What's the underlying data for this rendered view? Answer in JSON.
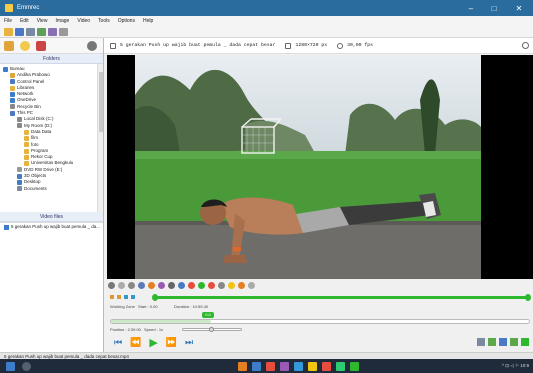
{
  "window": {
    "title": "Emmrec",
    "minimize_glyph": "–",
    "maximize_glyph": "□",
    "close_glyph": "✕"
  },
  "menu": [
    "File",
    "Edit",
    "View",
    "Image",
    "Video",
    "Tools",
    "Options",
    "Help"
  ],
  "toolbar_icons": [
    "open-folder-icon",
    "save-icon",
    "print-icon",
    "grid-icon",
    "film-icon",
    "settings-icon"
  ],
  "sidebar": {
    "tool_icons": [
      "pin-icon",
      "star-icon",
      "grid-icon",
      "help-icon"
    ],
    "folders_title": "Folders",
    "folders": [
      {
        "label": "Bureau",
        "level": 0,
        "icon": "desktop-icon"
      },
      {
        "label": "Andika Prabowo",
        "level": 1,
        "icon": "user-icon"
      },
      {
        "label": "Control Panel",
        "level": 1,
        "icon": "control-panel-icon"
      },
      {
        "label": "Libraries",
        "level": 1,
        "icon": "library-icon"
      },
      {
        "label": "Network",
        "level": 1,
        "icon": "network-icon"
      },
      {
        "label": "OneDrive",
        "level": 1,
        "icon": "cloud-icon"
      },
      {
        "label": "Recycle Bin",
        "level": 1,
        "icon": "recycle-bin-icon"
      },
      {
        "label": "This PC",
        "level": 1,
        "icon": "computer-icon"
      },
      {
        "label": "Local Disk (C:)",
        "level": 2,
        "icon": "drive-icon"
      },
      {
        "label": "My Room (D:)",
        "level": 2,
        "icon": "drive-icon"
      },
      {
        "label": "Data Data",
        "level": 3,
        "icon": "folder-icon"
      },
      {
        "label": "film",
        "level": 3,
        "icon": "folder-icon"
      },
      {
        "label": "foto",
        "level": 3,
        "icon": "folder-icon"
      },
      {
        "label": "Program",
        "level": 3,
        "icon": "folder-icon"
      },
      {
        "label": "Rekor Cup",
        "level": 3,
        "icon": "folder-icon"
      },
      {
        "label": "Universitas Bengkulu",
        "level": 3,
        "icon": "folder-icon"
      },
      {
        "label": "DVD RW Drive (E:)",
        "level": 2,
        "icon": "disc-icon"
      },
      {
        "label": "3D Objects",
        "level": 2,
        "icon": "cube-icon"
      },
      {
        "label": "Desktop",
        "level": 2,
        "icon": "desktop-icon"
      },
      {
        "label": "Documents",
        "level": 2,
        "icon": "documents-icon"
      }
    ],
    "video_files_title": "Video files",
    "video_files": [
      "5 gerakan Push up wajib buat pemula _ da..."
    ]
  },
  "address": {
    "filename": "5 gerakan Push up wajib buat pemula _ dada cepat besar",
    "resolution": "1280×720 px",
    "fps": "30,00 fps"
  },
  "controls": {
    "icons": [
      "clock-icon",
      "cursor-icon",
      "list-icon",
      "camera-icon",
      "pencil-icon",
      "angle-icon",
      "line-icon",
      "arrow-icon",
      "cross-icon",
      "link-icon",
      "circle-icon",
      "target-icon",
      "brush-icon",
      "color-icon",
      "zoom-icon"
    ]
  },
  "timeline": {
    "working_zone_label": "Working Zone",
    "start_label": "Start : 0.00",
    "duration_label": "Duration : 10:59.40",
    "position_marker": "0.0",
    "position_label": "Position : 2:39.00",
    "speed_label": "Speed : 1x",
    "progress": 0.24,
    "speed_level": 0.5
  },
  "status_text": "5 gerakan Push up wajib buat pemula _ dada cepat besar.mp4",
  "taskbar": {
    "apps": [
      "start-icon",
      "search-icon",
      "app-1",
      "app-2",
      "app-3",
      "app-4",
      "app-5",
      "app-6",
      "app-7",
      "app-8",
      "app-9"
    ],
    "tray_text": "^ ⊡ ◁ ⚐ 10:9"
  },
  "colors": {
    "titlebar": "#2b6c9e",
    "accent_green": "#2eb82e",
    "video_bg": "#000000"
  }
}
